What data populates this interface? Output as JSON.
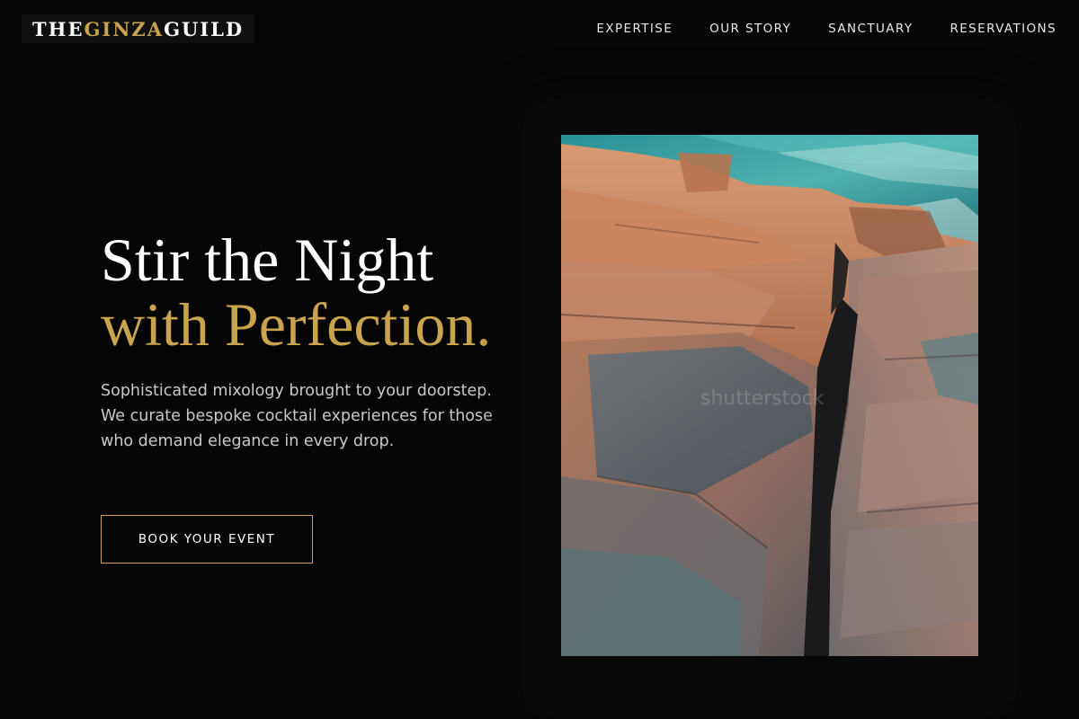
{
  "brand": {
    "part1": "THE ",
    "part2": "GINZA",
    "part3": " GUILD",
    "accent_color": "#c9a44c"
  },
  "nav": {
    "items": [
      {
        "label": "EXPERTISE"
      },
      {
        "label": "OUR STORY"
      },
      {
        "label": "SANCTUARY"
      },
      {
        "label": "RESERVATIONS"
      }
    ]
  },
  "hero": {
    "headline_line1": "Stir the Night",
    "headline_line2": "with Perfection.",
    "description": "Sophisticated mixology brought to your doorstep. We curate bespoke cocktail experiences for those who demand elegance in every drop.",
    "cta_label": "BOOK YOUR EVENT",
    "image": {
      "subject": "coastal rocks photo",
      "watermark": "shutterstock"
    }
  },
  "colors": {
    "background": "#050505",
    "text": "#ffffff",
    "muted_text": "#c9c9c9"
  }
}
